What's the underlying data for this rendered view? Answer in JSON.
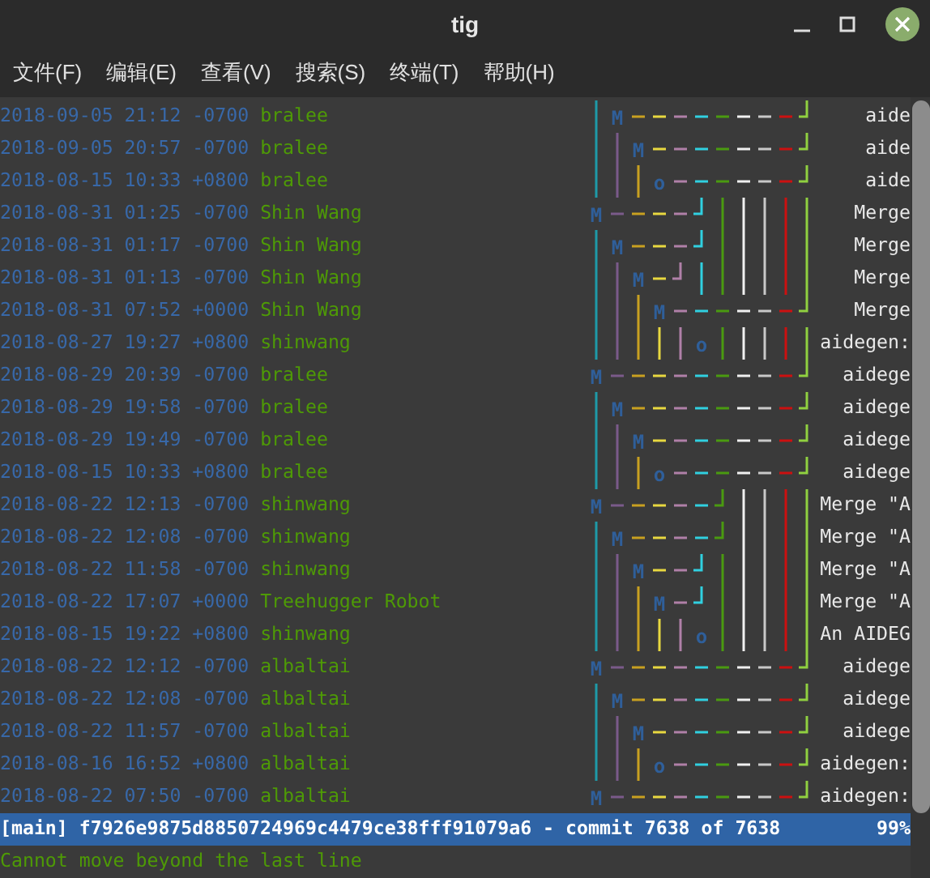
{
  "window": {
    "title": "tig"
  },
  "menu": [
    "文件(F)",
    "编辑(E)",
    "查看(V)",
    "搜索(S)",
    "终端(T)",
    "帮助(H)"
  ],
  "commits": [
    {
      "date": "2018-09-05 21:12 -0700",
      "author": "bralee",
      "graph_node": "M",
      "message": "aide"
    },
    {
      "date": "2018-09-05 20:57 -0700",
      "author": "bralee",
      "graph_node": "M",
      "message": "aide"
    },
    {
      "date": "2018-08-15 10:33 +0800",
      "author": "bralee",
      "graph_node": "o",
      "message": "aide"
    },
    {
      "date": "2018-08-31 01:25 -0700",
      "author": "Shin Wang",
      "graph_node": "M",
      "message": "Merge"
    },
    {
      "date": "2018-08-31 01:17 -0700",
      "author": "Shin Wang",
      "graph_node": "M",
      "message": "Merge"
    },
    {
      "date": "2018-08-31 01:13 -0700",
      "author": "Shin Wang",
      "graph_node": "M",
      "message": "Merge"
    },
    {
      "date": "2018-08-31 07:52 +0000",
      "author": "Shin Wang",
      "graph_node": "M",
      "message": "Merge"
    },
    {
      "date": "2018-08-27 19:27 +0800",
      "author": "shinwang",
      "graph_node": "o",
      "message": "aidegen:"
    },
    {
      "date": "2018-08-29 20:39 -0700",
      "author": "bralee",
      "graph_node": "M",
      "message": "aidege"
    },
    {
      "date": "2018-08-29 19:58 -0700",
      "author": "bralee",
      "graph_node": "M",
      "message": "aidege"
    },
    {
      "date": "2018-08-29 19:49 -0700",
      "author": "bralee",
      "graph_node": "M",
      "message": "aidege"
    },
    {
      "date": "2018-08-15 10:33 +0800",
      "author": "bralee",
      "graph_node": "o",
      "message": "aidege"
    },
    {
      "date": "2018-08-22 12:13 -0700",
      "author": "shinwang",
      "graph_node": "M",
      "message": "Merge \"A"
    },
    {
      "date": "2018-08-22 12:08 -0700",
      "author": "shinwang",
      "graph_node": "M",
      "message": "Merge \"A"
    },
    {
      "date": "2018-08-22 11:58 -0700",
      "author": "shinwang",
      "graph_node": "M",
      "message": "Merge \"A"
    },
    {
      "date": "2018-08-22 17:07 +0000",
      "author": "Treehugger Robot",
      "graph_node": "M",
      "message": "Merge \"A"
    },
    {
      "date": "2018-08-15 19:22 +0800",
      "author": "shinwang",
      "graph_node": "o",
      "message": "An AIDEG"
    },
    {
      "date": "2018-08-22 12:12 -0700",
      "author": "albaltai",
      "graph_node": "M",
      "message": "aidege"
    },
    {
      "date": "2018-08-22 12:08 -0700",
      "author": "albaltai",
      "graph_node": "M",
      "message": "aidege"
    },
    {
      "date": "2018-08-22 11:57 -0700",
      "author": "albaltai",
      "graph_node": "M",
      "message": "aidege"
    },
    {
      "date": "2018-08-16 16:52 +0800",
      "author": "albaltai",
      "graph_node": "o",
      "message": "aidegen:"
    },
    {
      "date": "2018-08-22 07:50 -0700",
      "author": "albaltai",
      "graph_node": "M",
      "message": "aidegen:"
    }
  ],
  "status_bar": {
    "text": "[main] f7926e9875d8850724969c4479ce38fff91079a6 - commit 7638 of 7638",
    "percent": "99%"
  },
  "message_line": "Cannot move beyond the last line"
}
